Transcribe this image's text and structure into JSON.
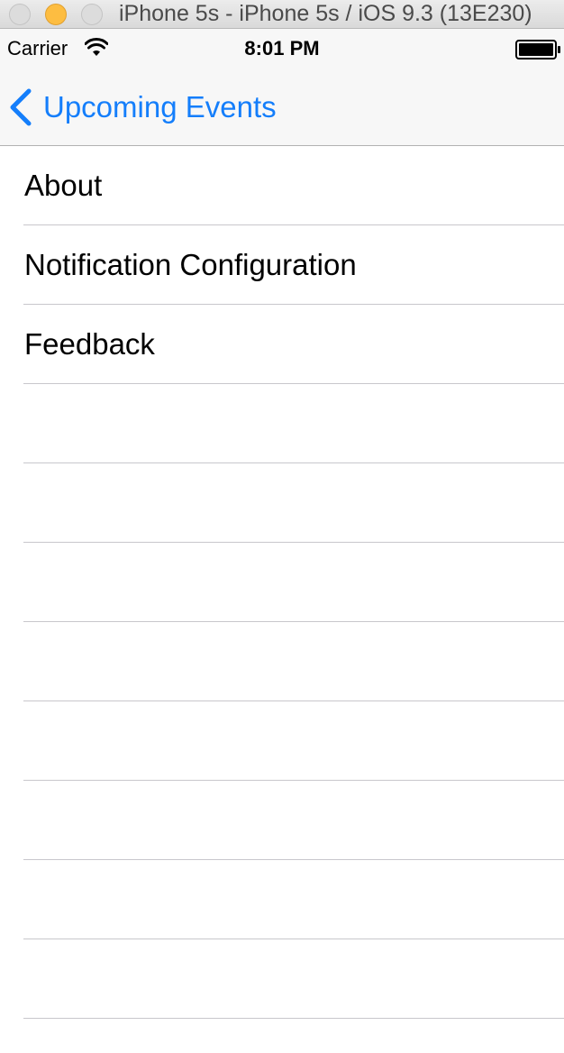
{
  "window": {
    "title": "iPhone 5s - iPhone 5s / iOS 9.3 (13E230)"
  },
  "status_bar": {
    "carrier": "Carrier",
    "time": "8:01 PM",
    "wifi_icon": "wifi-icon",
    "battery_icon": "battery-icon"
  },
  "nav_bar": {
    "back_label": "Upcoming Events",
    "back_icon": "chevron-left-icon"
  },
  "table": {
    "items": [
      {
        "label": "About"
      },
      {
        "label": "Notification Configuration"
      },
      {
        "label": "Feedback"
      },
      {
        "label": ""
      },
      {
        "label": ""
      },
      {
        "label": ""
      },
      {
        "label": ""
      },
      {
        "label": ""
      },
      {
        "label": ""
      },
      {
        "label": ""
      },
      {
        "label": ""
      }
    ]
  },
  "colors": {
    "tint": "#147efb",
    "separator": "#c8c7cc",
    "bar_background": "#f7f7f7"
  }
}
